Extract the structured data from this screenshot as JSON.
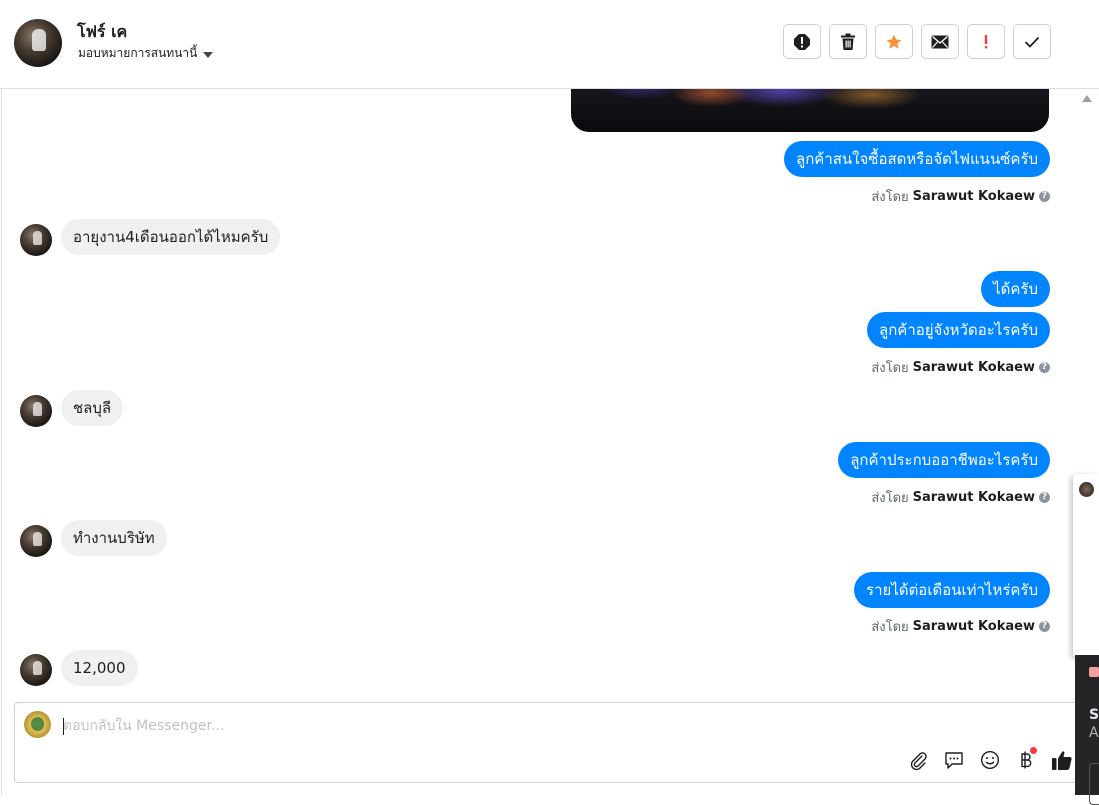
{
  "header": {
    "contact_name": "โฟร์ เค",
    "assign_label": "มอบหมายการสนทนานี้"
  },
  "toolbar": {
    "buttons": [
      "report-icon",
      "trash-icon",
      "star-icon",
      "mail-icon",
      "exclamation-icon",
      "check-icon"
    ],
    "star_color": "#f7923a",
    "exclamation_color": "#fa383e"
  },
  "messages": {
    "m1_text": "ลูกค้าสนใจซื้อสดหรือจัดไฟแนนซ์ครับ",
    "m1_sent_prefix": "ส่งโดย",
    "m1_sender": "Sarawut Kokaew",
    "m2_text": "อายุงาน4เดือนออกได้ไหมครับ",
    "m3_text": "ได้ครับ",
    "m4_text": "ลูกค้าอยู่จังหวัดอะไรครับ",
    "m4_sent_prefix": "ส่งโดย",
    "m4_sender": "Sarawut Kokaew",
    "m5_text": "ชลบุลี",
    "m6_text": "ลูกค้าประกบออาชีพอะไรครับ",
    "m6_sent_prefix": "ส่งโดย",
    "m6_sender": "Sarawut Kokaew",
    "m7_text": "ทำงานบริษัท",
    "m8_text": "รายได้ต่อเดือนเท่าไหร่ครับ",
    "m8_sent_prefix": "ส่งโดย",
    "m8_sender": "Sarawut Kokaew",
    "m9_text": "12,000"
  },
  "composer": {
    "placeholder": "ตอบกลับใน Messenger...",
    "icons": [
      "paperclip-icon",
      "saved-reply-icon",
      "emoji-icon",
      "baht-payment-icon",
      "thumbs-up-icon"
    ]
  },
  "side_panel": {
    "dark_line1": "Se",
    "dark_line2": "A"
  },
  "colors": {
    "outgoing_bubble": "#0084ff",
    "incoming_bubble": "#f0f0f0",
    "like_icon": "#1c1e21"
  }
}
